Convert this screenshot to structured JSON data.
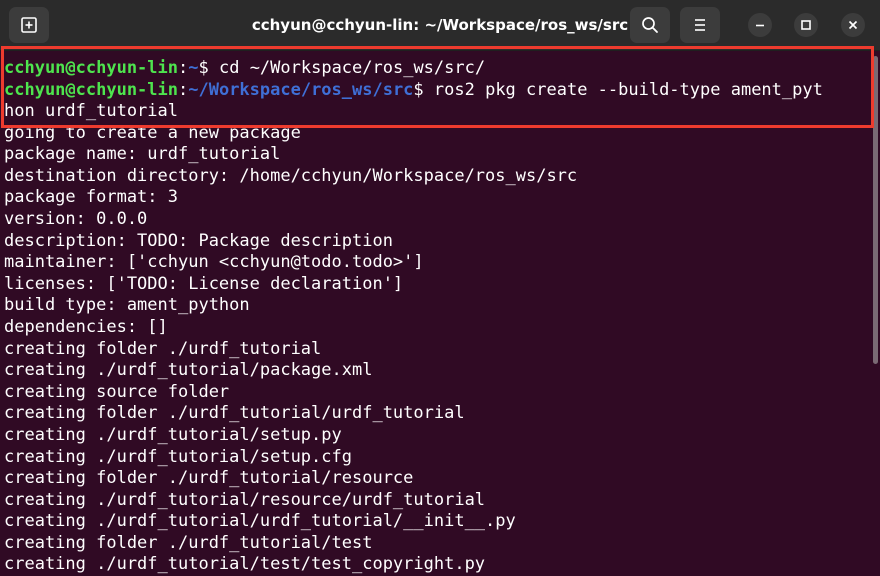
{
  "window": {
    "title": "cchyun@cchyun-lin: ~/Workspace/ros_ws/src",
    "buttons": {
      "new_tab_icon": "new-tab-icon",
      "search_icon": "search-icon",
      "menu_icon": "hamburger-menu-icon",
      "minimize_icon": "minimize-icon",
      "maximize_icon": "maximize-icon",
      "close_icon": "close-icon"
    }
  },
  "terminal": {
    "prompt1": {
      "user": "cchyun@cchyun-lin",
      "sep": ":",
      "path": "~",
      "dollar": "$",
      "command": " cd ~/Workspace/ros_ws/src/"
    },
    "prompt2": {
      "user": "cchyun@cchyun-lin",
      "sep": ":",
      "path": "~/Workspace/ros_ws/src",
      "dollar": "$",
      "command": " ros2 pkg create --build-type ament_pyt"
    },
    "wrap": "hon urdf_tutorial",
    "output": [
      "going to create a new package",
      "package name: urdf_tutorial",
      "destination directory: /home/cchyun/Workspace/ros_ws/src",
      "package format: 3",
      "version: 0.0.0",
      "description: TODO: Package description",
      "maintainer: ['cchyun <cchyun@todo.todo>']",
      "licenses: ['TODO: License declaration']",
      "build type: ament_python",
      "dependencies: []",
      "creating folder ./urdf_tutorial",
      "creating ./urdf_tutorial/package.xml",
      "creating source folder",
      "creating folder ./urdf_tutorial/urdf_tutorial",
      "creating ./urdf_tutorial/setup.py",
      "creating ./urdf_tutorial/setup.cfg",
      "creating folder ./urdf_tutorial/resource",
      "creating ./urdf_tutorial/resource/urdf_tutorial",
      "creating ./urdf_tutorial/urdf_tutorial/__init__.py",
      "creating folder ./urdf_tutorial/test",
      "creating ./urdf_tutorial/test/test_copyright.py"
    ]
  },
  "colors": {
    "background": "#300a24",
    "prompt_user": "#4ee44e",
    "prompt_path": "#3f6fd6",
    "highlight_box": "#ee3b2e"
  }
}
